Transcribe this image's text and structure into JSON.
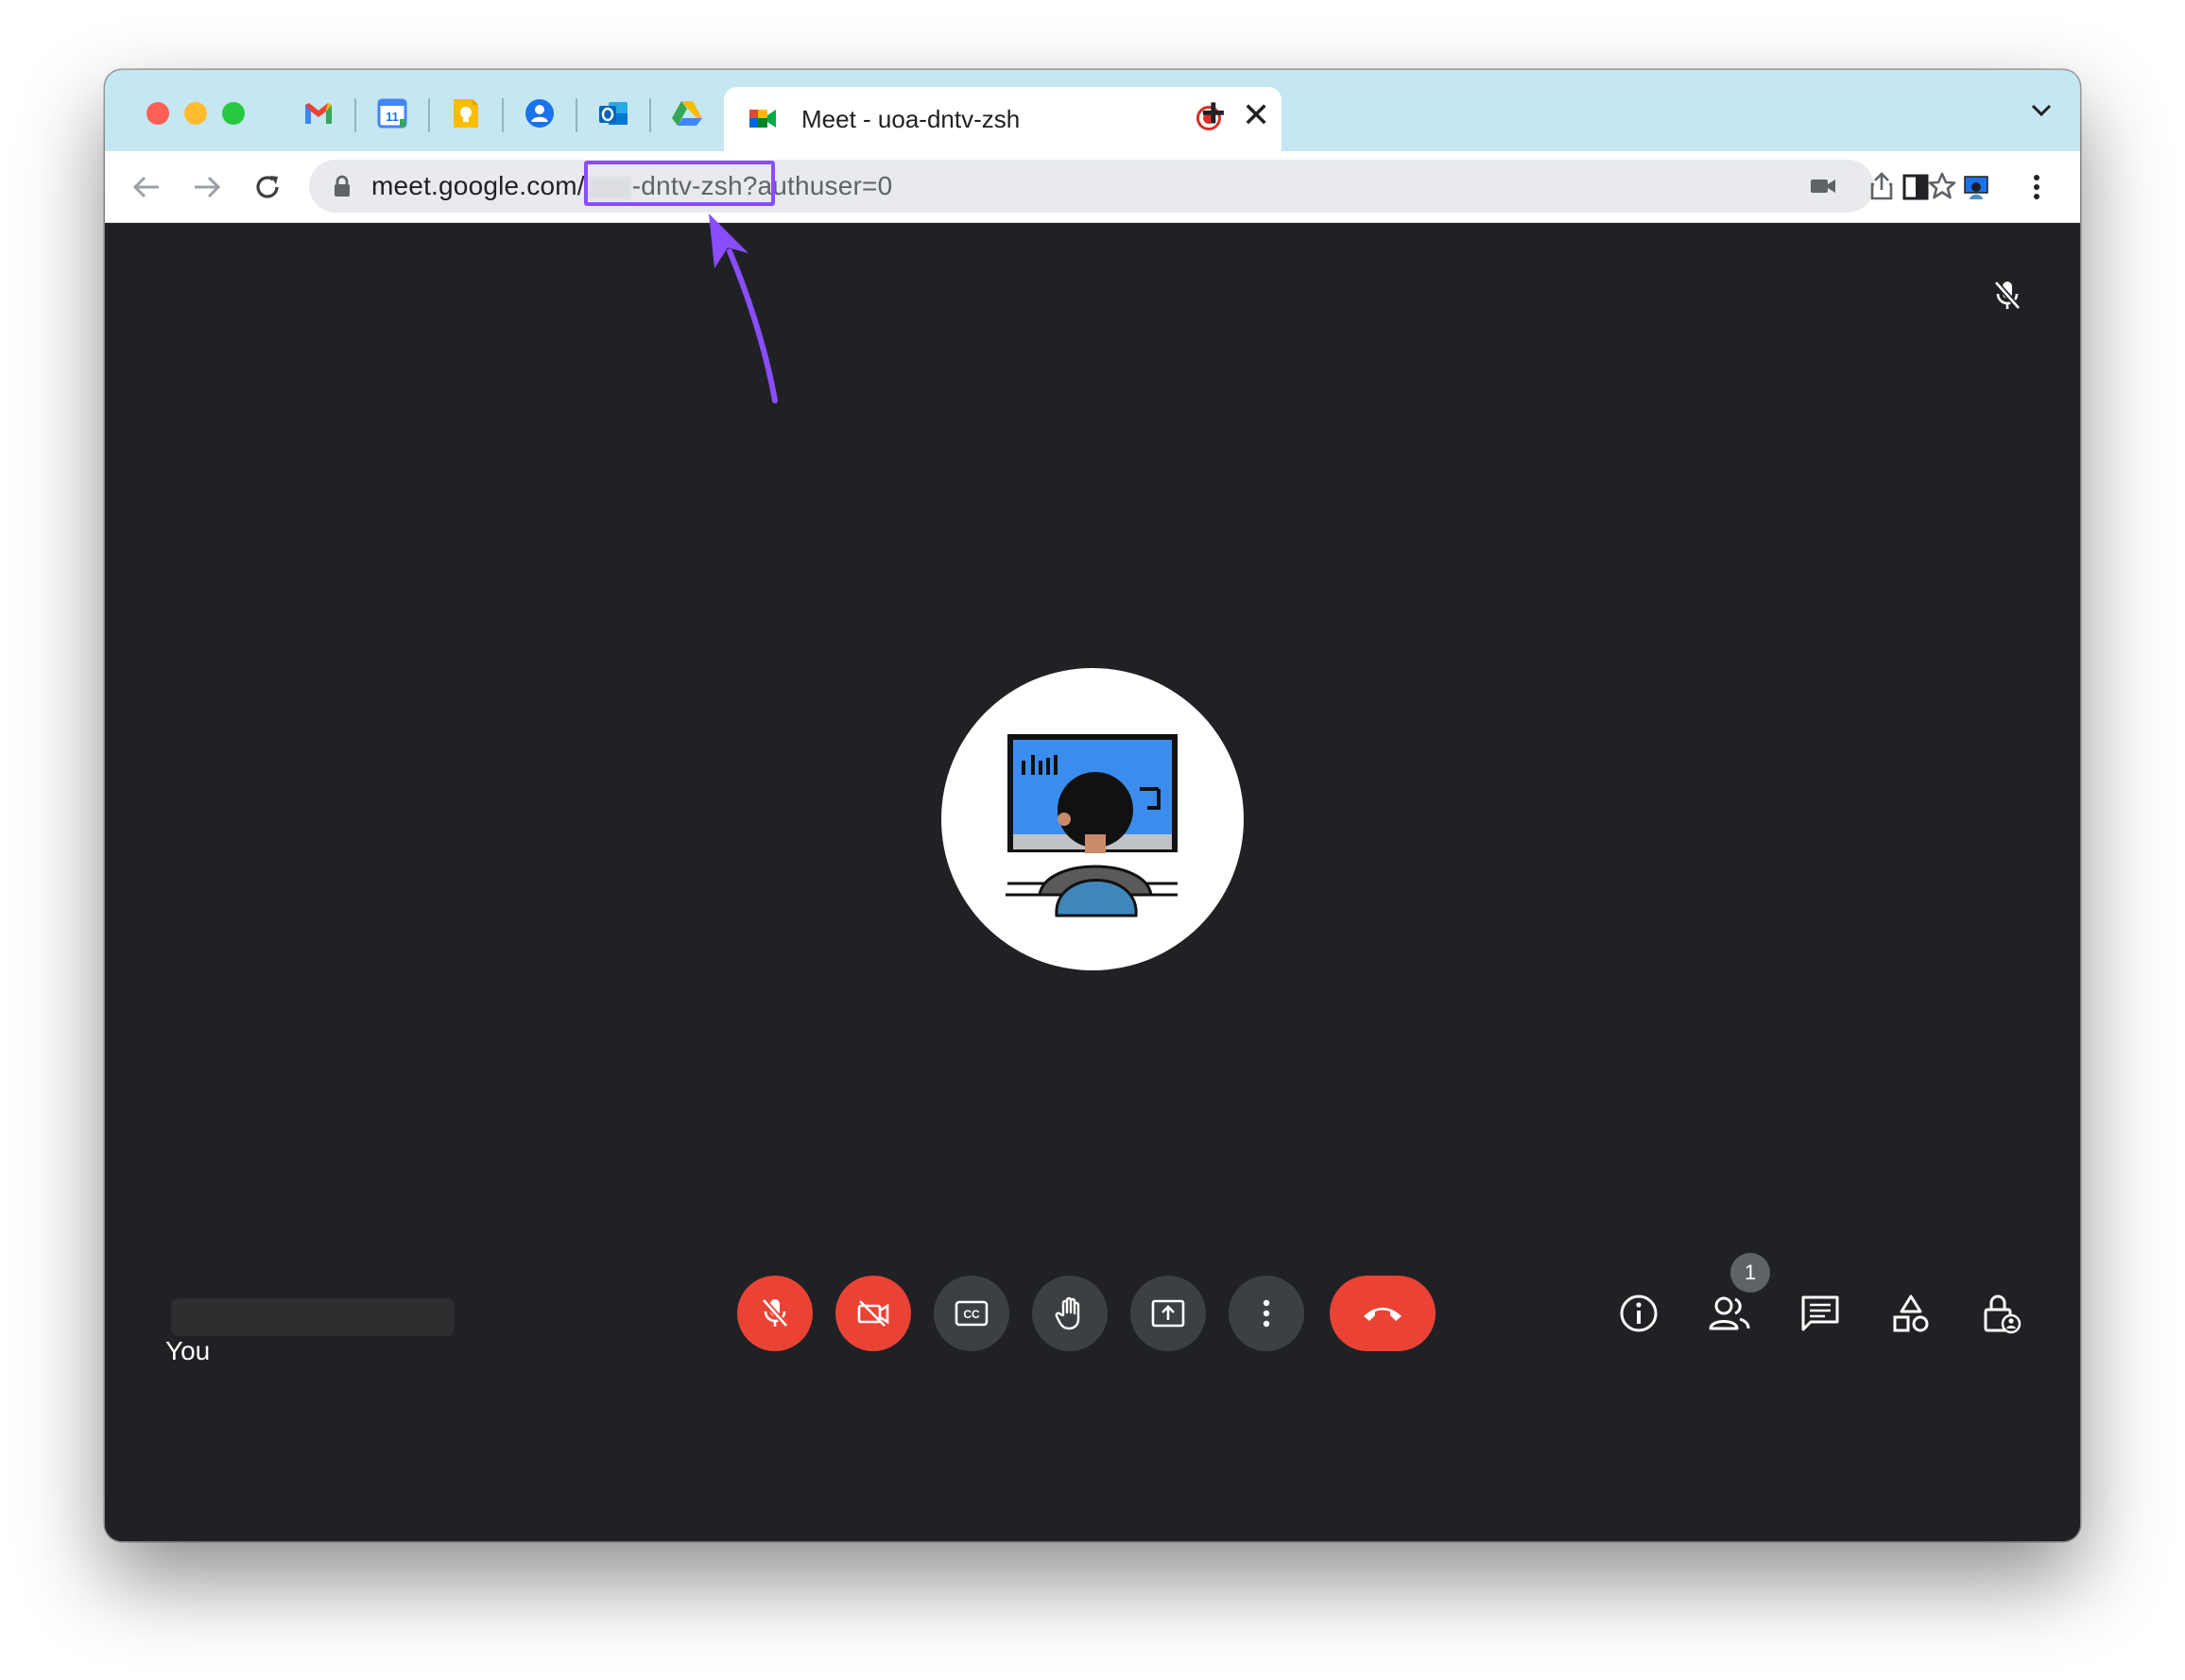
{
  "browser": {
    "pinned_tabs": [
      {
        "name": "gmail",
        "icon": "gmail-icon"
      },
      {
        "name": "calendar",
        "icon": "calendar-icon",
        "label": "11"
      },
      {
        "name": "keep",
        "icon": "keep-icon"
      },
      {
        "name": "contacts",
        "icon": "contacts-icon"
      },
      {
        "name": "outlook",
        "icon": "outlook-icon"
      },
      {
        "name": "drive",
        "icon": "drive-icon"
      }
    ],
    "active_tab": {
      "title": "Meet - uoa-dntv-zsh",
      "icon": "meet-icon",
      "recording": true
    },
    "url": {
      "host": "meet.google.com/",
      "code_visible": "-dntv-zsh",
      "query": "?authuser=0"
    }
  },
  "meeting": {
    "self_label": "You",
    "participants_count": "1"
  },
  "colors": {
    "accent": "#8a4dff",
    "danger": "#ea4335",
    "control_grey": "#3c4043",
    "stage_bg": "#202124",
    "tabstrip_bg": "#c5e7f1"
  }
}
